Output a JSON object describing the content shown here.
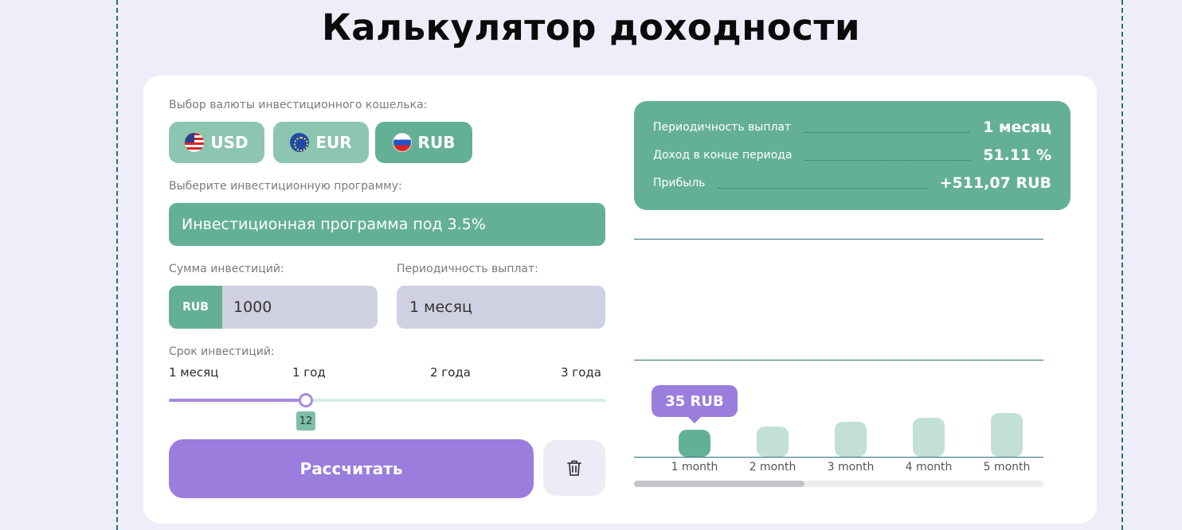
{
  "title": "Калькулятор доходности",
  "currency": {
    "label": "Выбор валюты инвестиционного кошелька:",
    "options": [
      {
        "code": "USD",
        "icon": "us-flag-icon",
        "active": false
      },
      {
        "code": "EUR",
        "icon": "eu-flag-icon",
        "active": false
      },
      {
        "code": "RUB",
        "icon": "ru-flag-icon",
        "active": true
      }
    ]
  },
  "program": {
    "label": "Выберите инвестиционную программу:",
    "value": "Инвестиционная программа под 3.5%"
  },
  "amount": {
    "label": "Сумма инвестиций:",
    "currency": "RUB",
    "value": "1000"
  },
  "payout_period": {
    "label": "Периодичность выплат:",
    "value": "1 месяц"
  },
  "term": {
    "label": "Срок инвестиций:",
    "ticks": [
      "1 месяц",
      "1 год",
      "2 года",
      "3 года"
    ],
    "value": "12",
    "min": 1,
    "max": 36
  },
  "actions": {
    "calculate_label": "Рассчитать",
    "clear_icon": "trash-icon"
  },
  "summary": {
    "rows": [
      {
        "label": "Периодичность выплат",
        "value": "1 месяц"
      },
      {
        "label": "Доход в конце периода",
        "value": "51.11 %"
      },
      {
        "label": "Прибыль",
        "value": "+511,07 RUB"
      }
    ]
  },
  "colors": {
    "accent_green": "#64b096",
    "accent_purple": "#9a7ddc",
    "background": "#eeeefa"
  },
  "chart_data": {
    "type": "bar",
    "categories": [
      "1 month",
      "2 month",
      "3 month",
      "4 month",
      "5 month"
    ],
    "values": [
      35,
      40,
      46,
      51,
      57
    ],
    "active_index": 0,
    "tooltip": "35 RUB",
    "ylim": [
      0,
      290
    ]
  }
}
